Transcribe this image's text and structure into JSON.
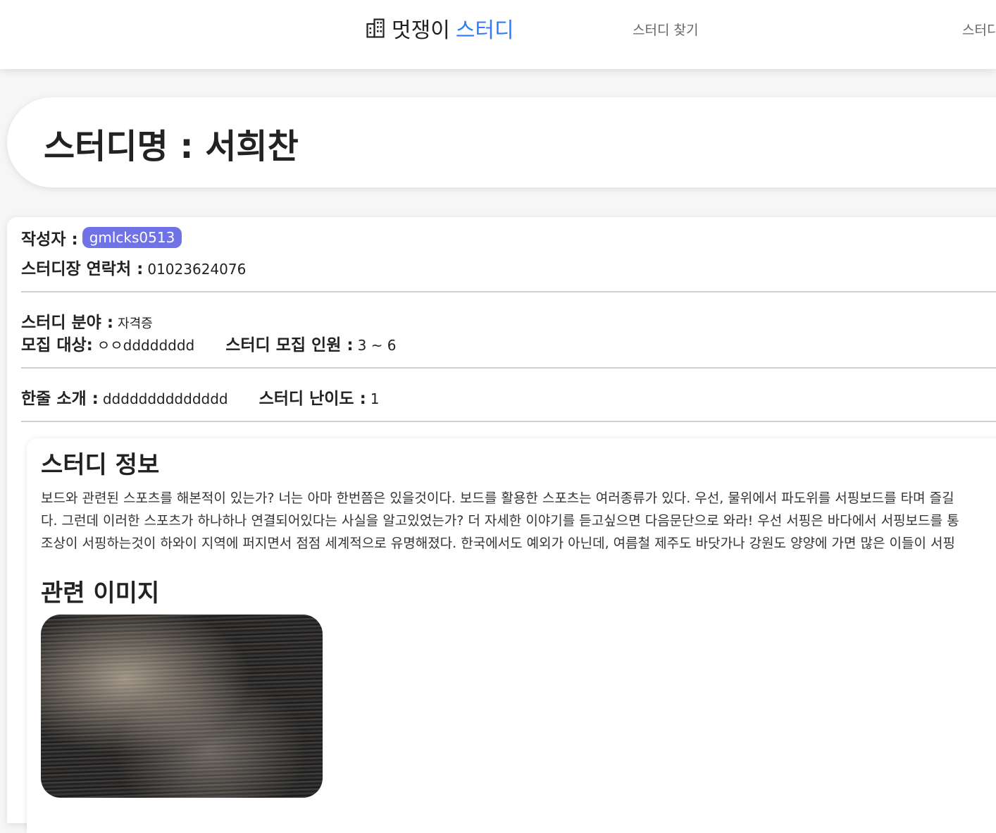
{
  "nav": {
    "brand_prefix": "멋쟁이",
    "brand_accent": "스터디",
    "brand_icon": "building-icon",
    "links": [
      "스터디 찾기",
      "스터디"
    ]
  },
  "study": {
    "title": "스터디명 : 서희찬",
    "author_label": "작성자 :",
    "author": "gmlcks0513",
    "contact_label": "스터디장 연락처 :",
    "contact": "01023624076",
    "field_label": "스터디 분야 :",
    "field": "자격증",
    "target_label": "모집 대상:",
    "target": "ㅇㅇdddddddd",
    "capacity_label": "스터디 모집 인원 :",
    "capacity": "3 ~ 6",
    "intro_label": "한줄 소개 :",
    "intro": "dddddddddddddd",
    "difficulty_label": "스터디 난이도 :",
    "difficulty": "1"
  },
  "info": {
    "heading": "스터디 정보",
    "lines": [
      "보드와 관련된 스포츠를 해본적이 있는가? 너는 아마 한번쯤은 있을것이다. 보드를 활용한 스포츠는 여러종류가 있다. 우선, 물위에서 파도위를 서핑보드를 타며 즐길",
      "다. 그런데 이러한 스포츠가 하나하나 연결되어있다는 사실을 알고있었는가? 더 자세한 이야기를 듣고싶으면 다음문단으로 와라! 우선 서핑은 바다에서 서핑보드를 통",
      "조상이 서핑하는것이 하와이 지역에 퍼지면서 점점 세계적으로 유명해졌다. 한국에서도 예외가 아닌데, 여름철 제주도 바닷가나 강원도 양양에 가면 많은 이들이 서핑"
    ],
    "images_heading": "관련 이미지"
  },
  "colors": {
    "accent": "#2f7cf6",
    "badge": "#7073e8"
  }
}
